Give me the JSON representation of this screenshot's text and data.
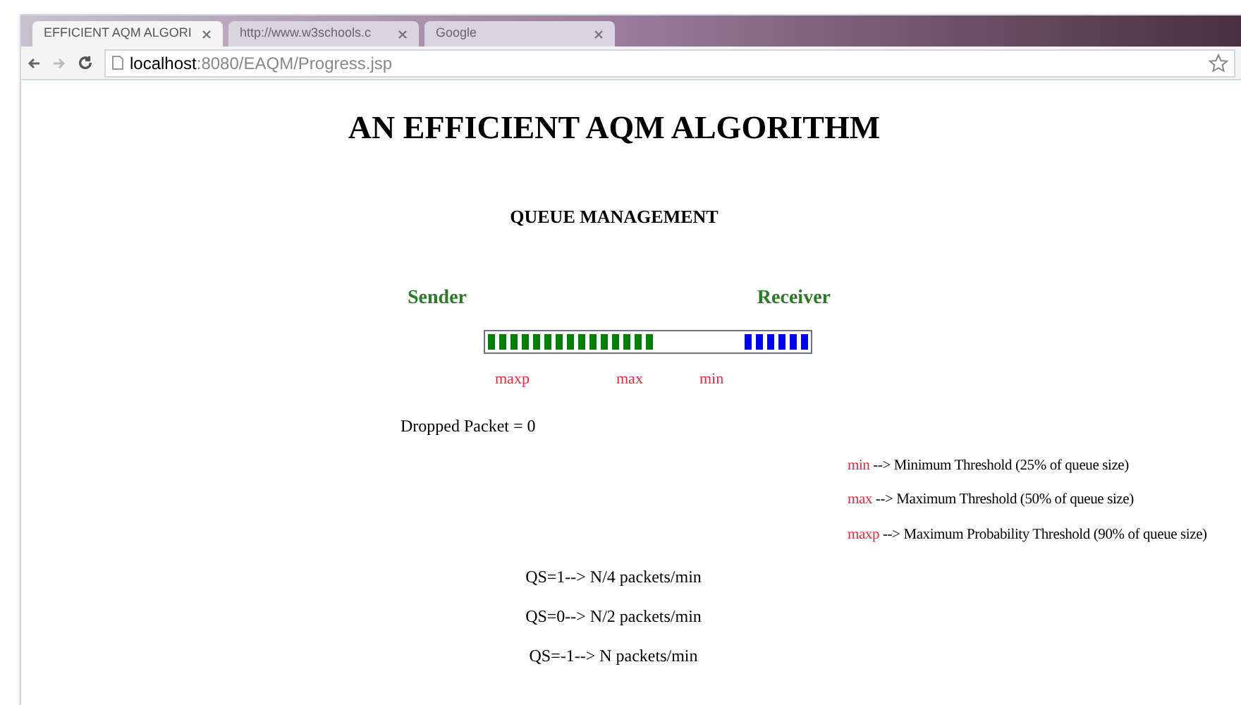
{
  "tabs": [
    {
      "title": "EFFICIENT AQM ALGORI",
      "selected": true
    },
    {
      "title": "http://www.w3schools.c",
      "selected": false
    },
    {
      "title": "Google",
      "selected": false
    }
  ],
  "address_bar": {
    "host": "localhost",
    "path": ":8080/EAQM/Progress.jsp"
  },
  "page": {
    "title": "AN EFFICIENT AQM ALGORITHM",
    "subtitle": "QUEUE MANAGEMENT",
    "sender_label": "Sender",
    "receiver_label": "Receiver",
    "packets": [
      {
        "color": "#008000"
      },
      {
        "color": "#008000"
      },
      {
        "color": "#008000"
      },
      {
        "color": "#008000"
      },
      {
        "color": "#008000"
      },
      {
        "color": "#008000"
      },
      {
        "color": "#008000"
      },
      {
        "color": "#008000"
      },
      {
        "color": "#008000"
      },
      {
        "color": "#008000"
      },
      {
        "color": "#008000"
      },
      {
        "color": "#008000"
      },
      {
        "color": "#008000"
      },
      {
        "color": "#008000"
      },
      {
        "color": "#008000"
      },
      {
        "color": "#0000ff"
      },
      {
        "color": "#0000ff"
      },
      {
        "color": "#0000ff"
      },
      {
        "color": "#0000ff"
      },
      {
        "color": "#0000ff"
      },
      {
        "color": "#0000ff"
      }
    ],
    "markers": [
      "maxp",
      "max",
      "min"
    ],
    "dropped": "Dropped Packet = 0",
    "legend": [
      {
        "term": "min",
        "text": "--> Minimum Threshold (25% of queue size)"
      },
      {
        "term": "max",
        "text": "--> Maximum Threshold (50% of queue size)"
      },
      {
        "term": "maxp",
        "text": "--> Maximum Probability Threshold (90% of queue size)"
      }
    ],
    "rates": [
      "QS=1--> N/4 packets/min",
      "QS=0--> N/2 packets/min",
      "QS=-1--> N packets/min"
    ]
  }
}
